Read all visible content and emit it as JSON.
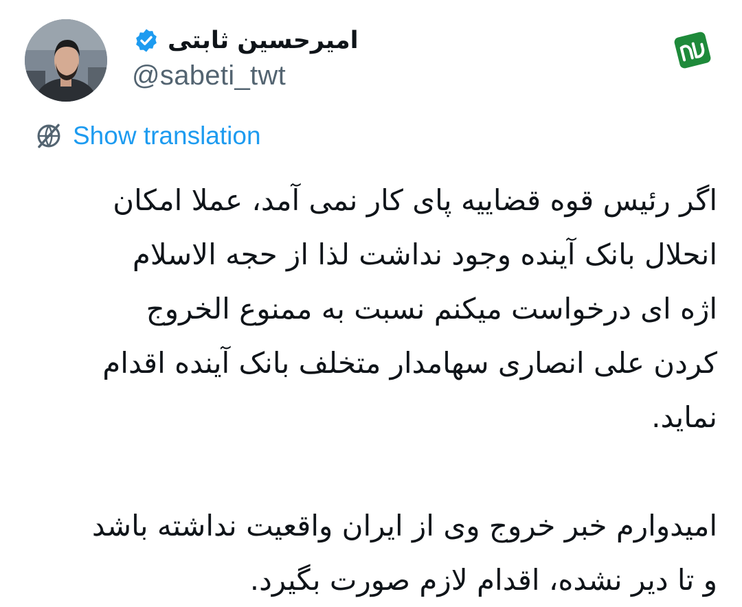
{
  "tweet": {
    "author": {
      "display_name": "امیرحسین ثابتی",
      "handle": "@sabeti_twt",
      "verified": true
    },
    "translate_label": "Show translation",
    "paragraphs": [
      "اگر رئیس قوه قضاییه پای کار نمی آمد، عملا امکان\nانحلال بانک آینده وجود نداشت لذا از حجه الاسلام\nاژه ای درخواست میکنم نسبت به ممنوع الخروج\nکردن علی انصاری سهامدار متخلف بانک آینده اقدام\nنماید.",
      "امیدوارم خبر خروج وی از ایران واقعیت نداشته باشد\nو تا دیر نشده، اقدام لازم صورت بگیرد."
    ]
  },
  "colors": {
    "link": "#1d9bf0",
    "secondary_text": "#536471",
    "verified_badge": "#1d9bf0",
    "source_logo": "#1e8a3a"
  },
  "icons": {
    "verified": "verified-badge-icon",
    "translate": "translate-globe-icon",
    "source": "source-logo"
  }
}
